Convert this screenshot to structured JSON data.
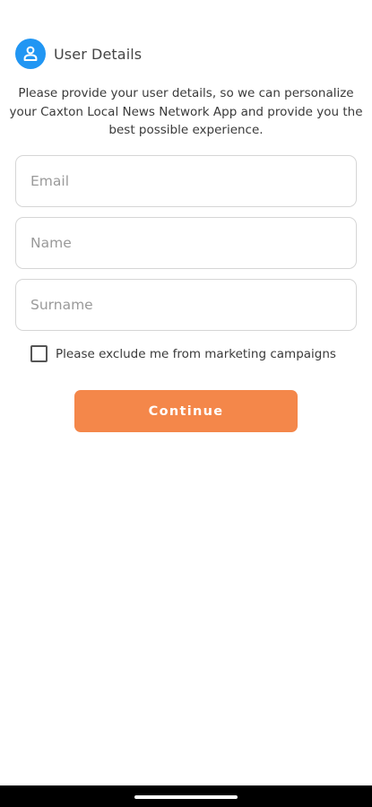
{
  "header": {
    "title": "User Details",
    "icon": "user-icon",
    "icon_color": "#2196f3"
  },
  "intro": {
    "text": "Please provide your user details, so we can personalize your Caxton Local News Network App and provide you the best possible experience."
  },
  "form": {
    "email": {
      "placeholder": "Email",
      "value": ""
    },
    "name": {
      "placeholder": "Name",
      "value": ""
    },
    "surname": {
      "placeholder": "Surname",
      "value": ""
    },
    "marketing_opt_out": {
      "label": "Please exclude me from marketing campaigns",
      "checked": false
    }
  },
  "actions": {
    "continue_label": "Continue",
    "accent_color": "#f4874a"
  }
}
